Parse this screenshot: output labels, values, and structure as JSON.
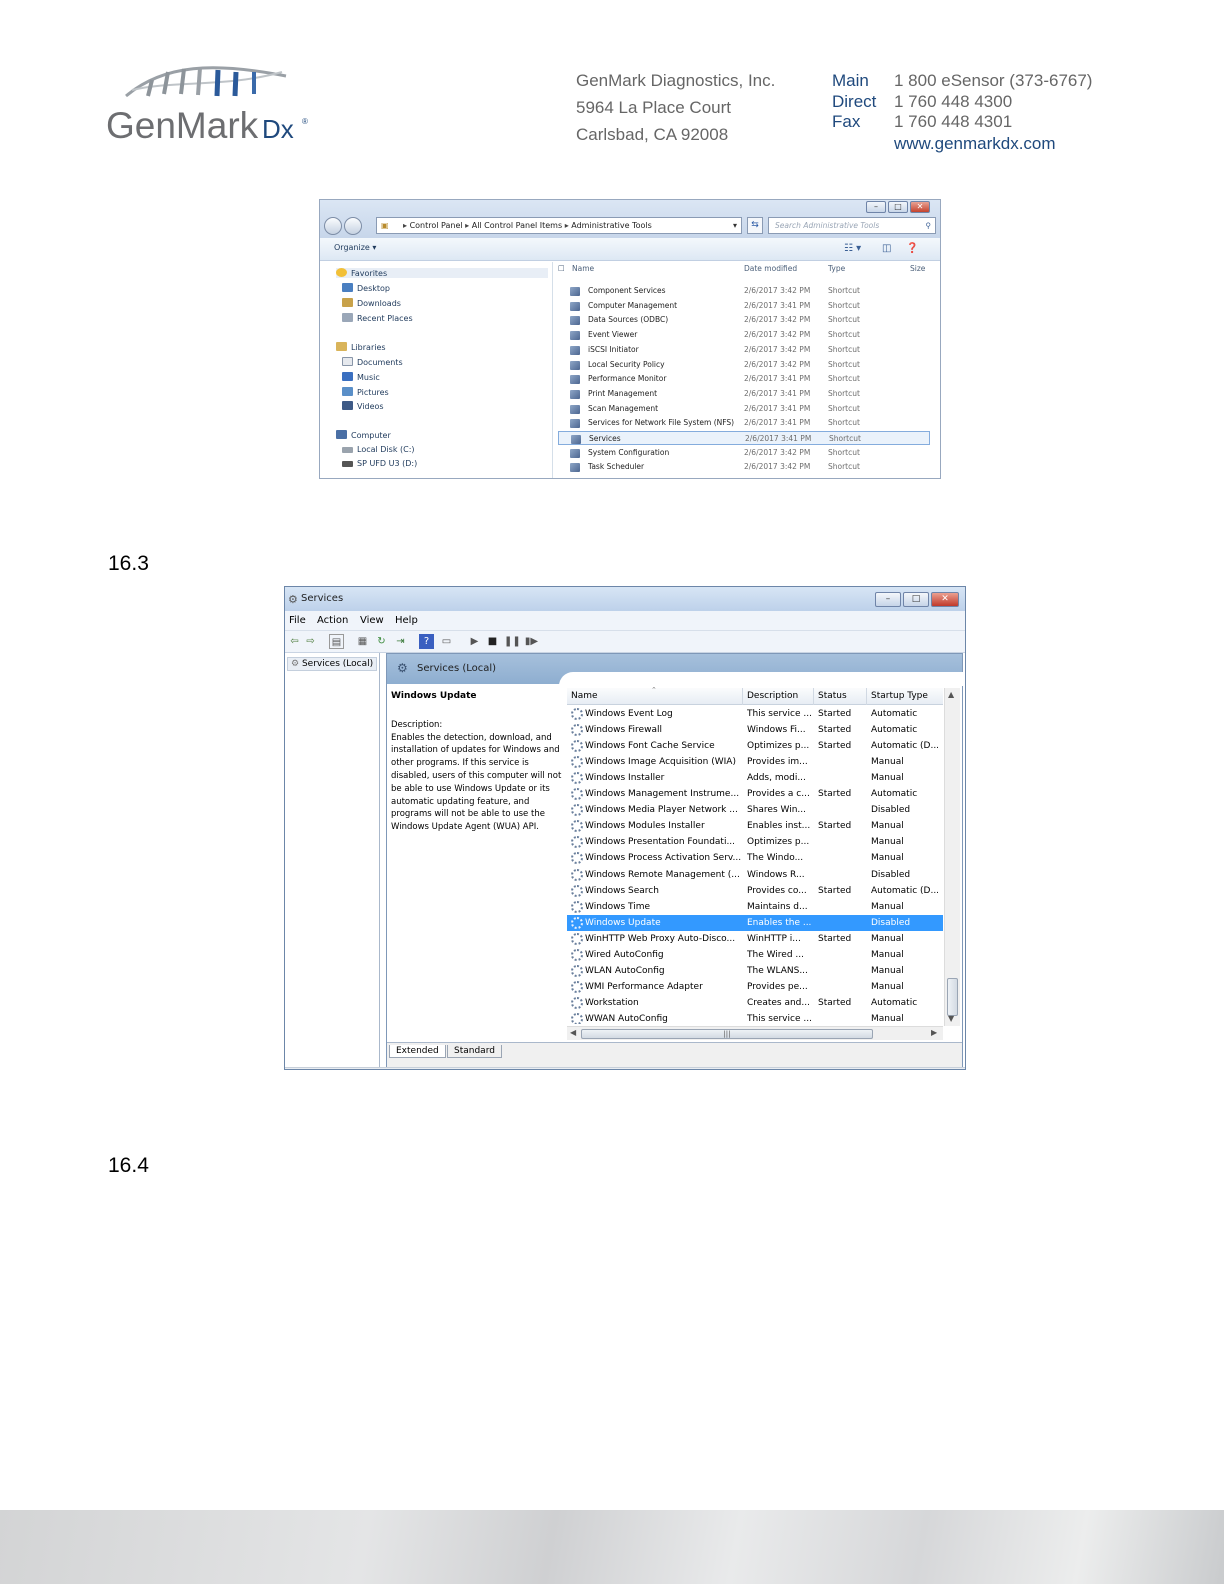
{
  "letterhead": {
    "logo_text": "GenMark",
    "logo_suffix": "Dx",
    "company": "GenMark Diagnostics, Inc.",
    "street": "5964 La Place Court",
    "city": "Carlsbad, CA 92008",
    "contacts": [
      {
        "label": "Main",
        "value": "1 800 eSensor (373-6767)"
      },
      {
        "label": "Direct",
        "value": "1 760 448 4300"
      },
      {
        "label": "Fax",
        "value": "1 760 448 4301"
      }
    ],
    "website": "www.genmarkdx.com"
  },
  "sections": [
    {
      "number": "16.3"
    },
    {
      "number": "16.4"
    }
  ],
  "explorer": {
    "address": [
      "Control Panel",
      "All Control Panel Items",
      "Administrative Tools"
    ],
    "search_placeholder": "Search Administrative Tools",
    "organize_label": "Organize",
    "nav": {
      "favorites": "Favorites",
      "favorites_items": [
        "Desktop",
        "Downloads",
        "Recent Places"
      ],
      "libraries": "Libraries",
      "libraries_items": [
        "Documents",
        "Music",
        "Pictures",
        "Videos"
      ],
      "computer": "Computer",
      "computer_items": [
        "Local Disk (C:)",
        "SP UFD U3 (D:)"
      ]
    },
    "columns": {
      "name": "Name",
      "date": "Date modified",
      "type": "Type",
      "size": "Size"
    },
    "files": [
      {
        "name": "Component Services",
        "date": "2/6/2017 3:42 PM",
        "type": "Shortcut"
      },
      {
        "name": "Computer Management",
        "date": "2/6/2017 3:41 PM",
        "type": "Shortcut"
      },
      {
        "name": "Data Sources (ODBC)",
        "date": "2/6/2017 3:42 PM",
        "type": "Shortcut"
      },
      {
        "name": "Event Viewer",
        "date": "2/6/2017 3:42 PM",
        "type": "Shortcut"
      },
      {
        "name": "iSCSI Initiator",
        "date": "2/6/2017 3:42 PM",
        "type": "Shortcut"
      },
      {
        "name": "Local Security Policy",
        "date": "2/6/2017 3:42 PM",
        "type": "Shortcut"
      },
      {
        "name": "Performance Monitor",
        "date": "2/6/2017 3:41 PM",
        "type": "Shortcut"
      },
      {
        "name": "Print Management",
        "date": "2/6/2017 3:41 PM",
        "type": "Shortcut"
      },
      {
        "name": "Scan Management",
        "date": "2/6/2017 3:41 PM",
        "type": "Shortcut"
      },
      {
        "name": "Services for Network File System (NFS)",
        "date": "2/6/2017 3:41 PM",
        "type": "Shortcut"
      },
      {
        "name": "Services",
        "date": "2/6/2017 3:41 PM",
        "type": "Shortcut"
      },
      {
        "name": "System Configuration",
        "date": "2/6/2017 3:42 PM",
        "type": "Shortcut"
      },
      {
        "name": "Task Scheduler",
        "date": "2/6/2017 3:42 PM",
        "type": "Shortcut"
      }
    ],
    "selected_file": "Services"
  },
  "services": {
    "title": "Services",
    "menu": [
      "File",
      "Action",
      "View",
      "Help"
    ],
    "tree_item": "Services (Local)",
    "header": "Services (Local)",
    "detail_title": "Windows Update",
    "description_label": "Description:",
    "description": "Enables the detection, download, and installation of updates for Windows and other programs. If this service is disabled, users of this computer will not be able to use Windows Update or its automatic updating feature, and programs will not be able to use the Windows Update Agent (WUA) API.",
    "columns": {
      "name": "Name",
      "description": "Description",
      "status": "Status",
      "startup": "Startup Type"
    },
    "rows": [
      {
        "name": "Windows Event Log",
        "description": "This service ...",
        "status": "Started",
        "startup": "Automatic"
      },
      {
        "name": "Windows Firewall",
        "description": "Windows Fi...",
        "status": "Started",
        "startup": "Automatic"
      },
      {
        "name": "Windows Font Cache Service",
        "description": "Optimizes p...",
        "status": "Started",
        "startup": "Automatic (D..."
      },
      {
        "name": "Windows Image Acquisition (WIA)",
        "description": "Provides im...",
        "status": "",
        "startup": "Manual"
      },
      {
        "name": "Windows Installer",
        "description": "Adds, modi...",
        "status": "",
        "startup": "Manual"
      },
      {
        "name": "Windows Management Instrume...",
        "description": "Provides a c...",
        "status": "Started",
        "startup": "Automatic"
      },
      {
        "name": "Windows Media Player Network ...",
        "description": "Shares Win...",
        "status": "",
        "startup": "Disabled"
      },
      {
        "name": "Windows Modules Installer",
        "description": "Enables inst...",
        "status": "Started",
        "startup": "Manual"
      },
      {
        "name": "Windows Presentation Foundati...",
        "description": "Optimizes p...",
        "status": "",
        "startup": "Manual"
      },
      {
        "name": "Windows Process Activation Serv...",
        "description": "The Windo...",
        "status": "",
        "startup": "Manual"
      },
      {
        "name": "Windows Remote Management (...",
        "description": "Windows R...",
        "status": "",
        "startup": "Disabled"
      },
      {
        "name": "Windows Search",
        "description": "Provides co...",
        "status": "Started",
        "startup": "Automatic (D..."
      },
      {
        "name": "Windows Time",
        "description": "Maintains d...",
        "status": "",
        "startup": "Manual"
      },
      {
        "name": "Windows Update",
        "description": "Enables the ...",
        "status": "",
        "startup": "Disabled"
      },
      {
        "name": "WinHTTP Web Proxy Auto-Disco...",
        "description": "WinHTTP i...",
        "status": "Started",
        "startup": "Manual"
      },
      {
        "name": "Wired AutoConfig",
        "description": "The Wired ...",
        "status": "",
        "startup": "Manual"
      },
      {
        "name": "WLAN AutoConfig",
        "description": "The WLANS...",
        "status": "",
        "startup": "Manual"
      },
      {
        "name": "WMI Performance Adapter",
        "description": "Provides pe...",
        "status": "",
        "startup": "Manual"
      },
      {
        "name": "Workstation",
        "description": "Creates and...",
        "status": "Started",
        "startup": "Automatic"
      },
      {
        "name": "WWAN AutoConfig",
        "description": "This service ...",
        "status": "",
        "startup": "Manual"
      }
    ],
    "selected_row": "Windows Update",
    "tabs": [
      "Extended",
      "Standard"
    ],
    "active_tab": "Extended",
    "selection_color": "#3399ff"
  },
  "brand_colors": {
    "blue": "#1f497d",
    "gray": "#666666"
  }
}
